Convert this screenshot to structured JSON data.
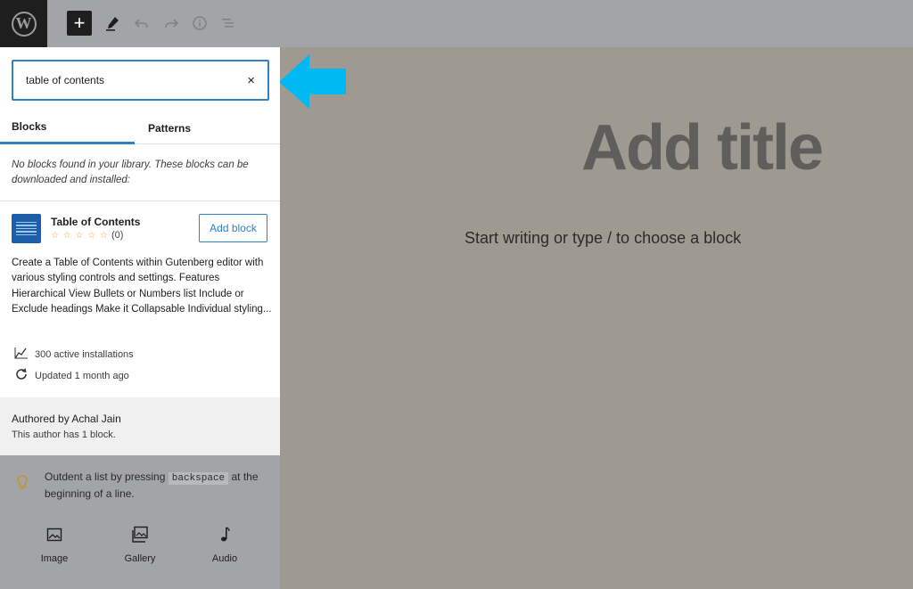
{
  "toolbar": {
    "logo_glyph": "W",
    "add_label": "+"
  },
  "search": {
    "value": "table of contents",
    "clear_label": "×"
  },
  "tabs": [
    {
      "label": "Blocks",
      "active": true
    },
    {
      "label": "Patterns",
      "active": false
    }
  ],
  "no_blocks_message": "No blocks found in your library. These blocks can be downloaded and installed:",
  "result": {
    "name": "Table of Contents",
    "stars": "☆ ☆ ☆ ☆ ☆",
    "rating_count": "(0)",
    "add_button": "Add block",
    "description": "Create a Table of Contents within Gutenberg editor with various styling controls and settings. Features Hierarchical View Bullets or Numbers list Include or Exclude headings Make it Collapsable Individual styling...",
    "installs": "300 active installations",
    "updated": "Updated 1 month ago"
  },
  "author": {
    "byline": "Authored by Achal Jain",
    "count": "This author has 1 block."
  },
  "tip": {
    "before": "Outdent a list by pressing ",
    "key": "backspace",
    "after": " at the beginning of a line."
  },
  "quick_blocks": [
    {
      "label": "Image",
      "icon": "image-icon"
    },
    {
      "label": "Gallery",
      "icon": "gallery-icon"
    },
    {
      "label": "Audio",
      "icon": "audio-icon"
    }
  ],
  "editor": {
    "title_placeholder": "Add title",
    "body_placeholder": "Start writing or type / to choose a block"
  },
  "colors": {
    "accent": "#2f81c4",
    "arrow": "#00b9f2",
    "overlay": "#9e9a92"
  }
}
